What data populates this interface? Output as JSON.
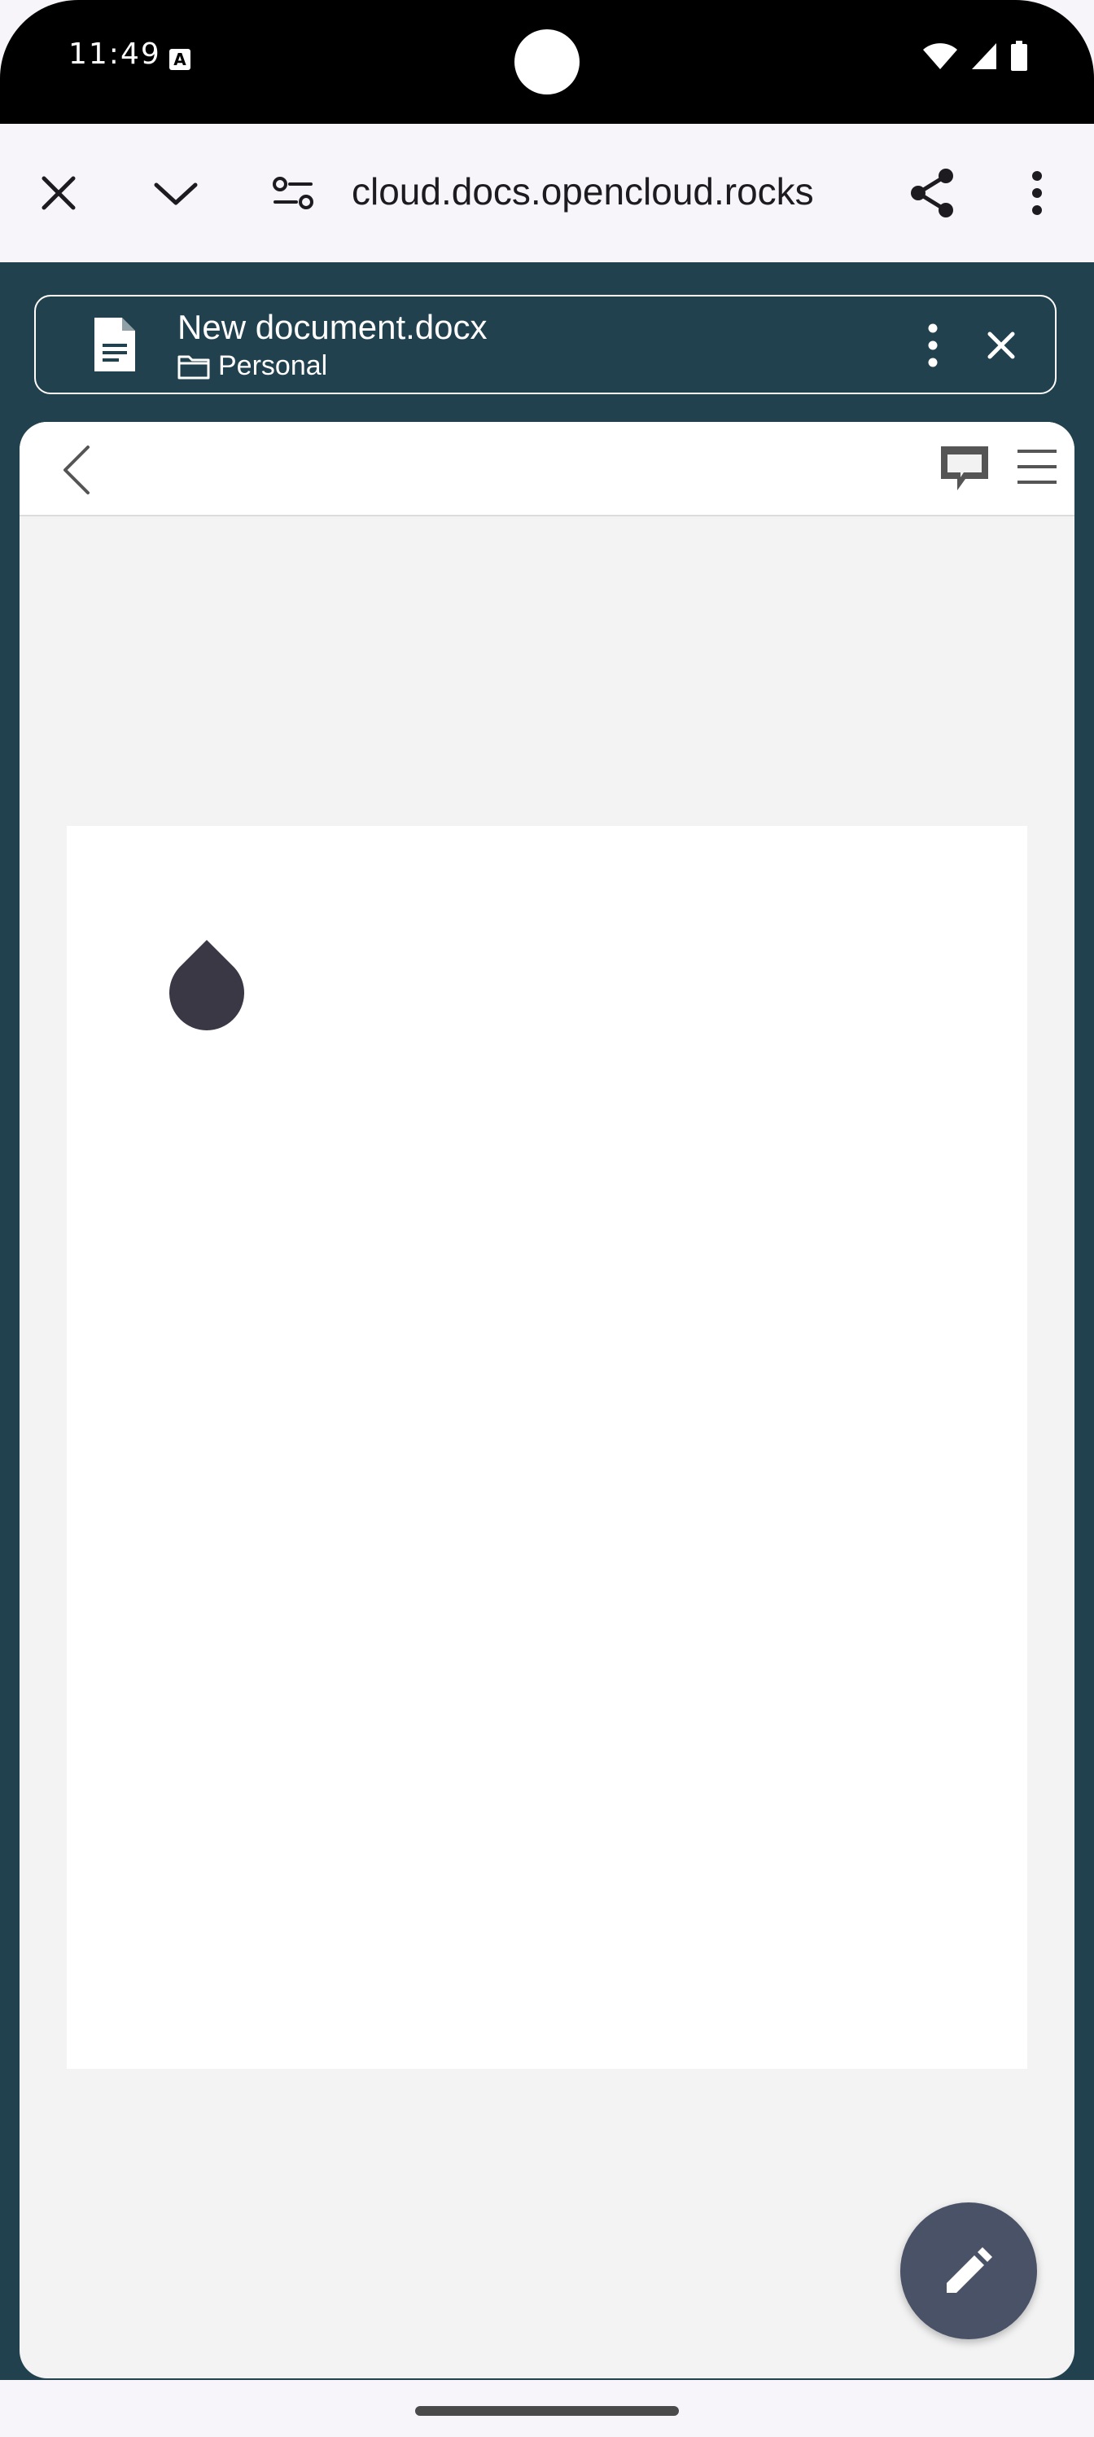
{
  "status_bar": {
    "time": "11:49",
    "notification_badge": "A",
    "icons": [
      "wifi-icon",
      "signal-icon",
      "battery-icon"
    ]
  },
  "browser": {
    "url": "cloud.docs.opencloud.rocks",
    "icons": [
      "close-icon",
      "chevron-down-icon",
      "site-settings-icon",
      "share-icon",
      "more-vert-icon"
    ]
  },
  "document": {
    "title": "New document.docx",
    "location": "Personal"
  },
  "editor": {
    "toolbar_icons": [
      "back-chevron-icon",
      "comments-icon",
      "hamburger-menu-icon"
    ],
    "fab_icon": "pencil-icon"
  },
  "colors": {
    "app_background": "#22414f",
    "editor_background": "#f3f3f3",
    "page": "#ffffff",
    "fab": "#4a5268",
    "cursor_handle": "#3b3845"
  }
}
